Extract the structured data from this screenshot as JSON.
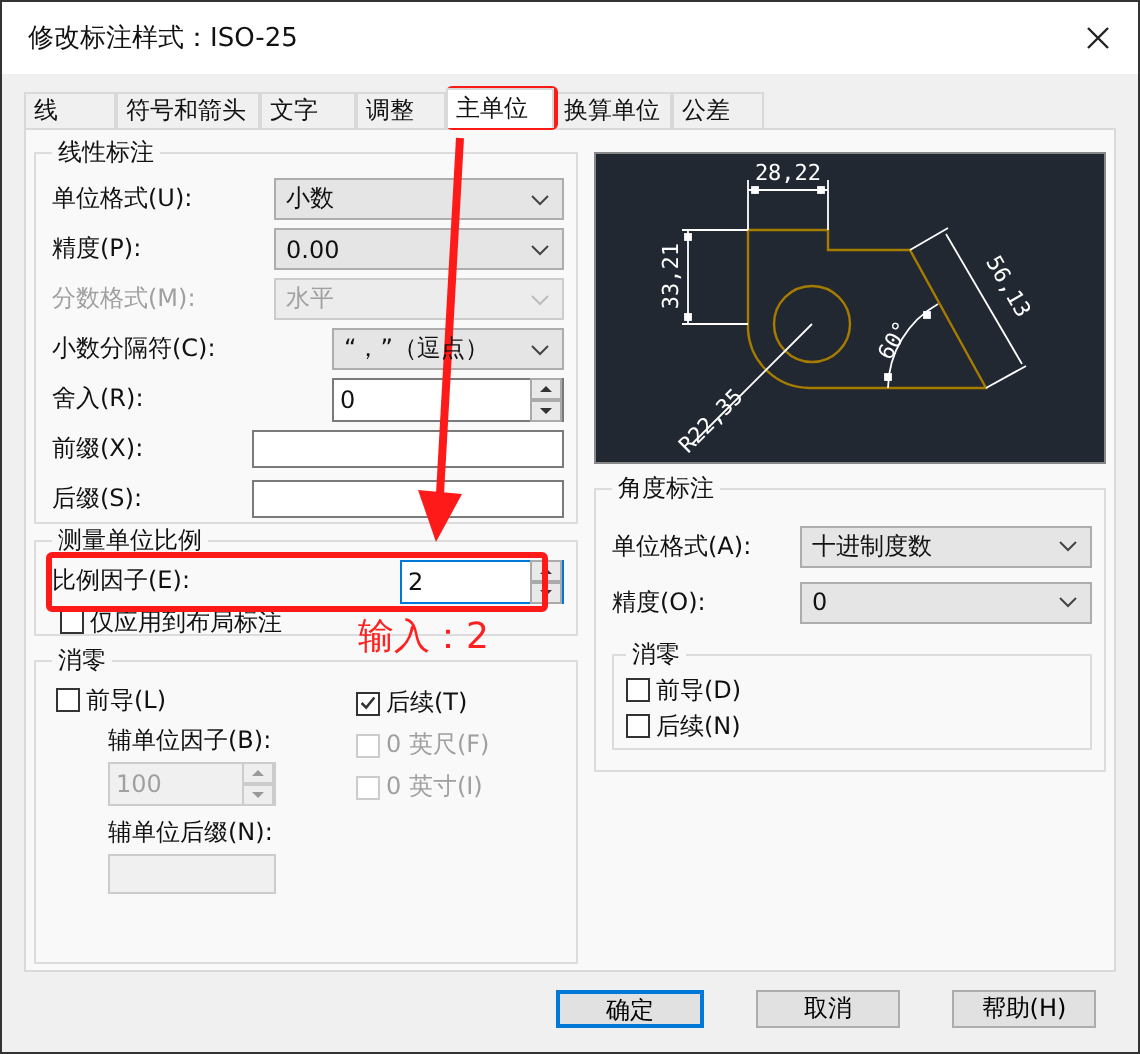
{
  "window": {
    "title": "修改标注样式：ISO-25"
  },
  "tabs": [
    {
      "label": "线",
      "selected": false
    },
    {
      "label": "符号和箭头",
      "selected": false
    },
    {
      "label": "文字",
      "selected": false
    },
    {
      "label": "调整",
      "selected": false
    },
    {
      "label": "主单位",
      "selected": true
    },
    {
      "label": "换算单位",
      "selected": false
    },
    {
      "label": "公差",
      "selected": false
    }
  ],
  "linear": {
    "title": "线性标注",
    "fields": [
      {
        "kind": "select",
        "label": "单位格式(U):",
        "value": "小数",
        "disabled": false
      },
      {
        "kind": "select",
        "label": "精度(P):",
        "value": "0.00",
        "disabled": false
      },
      {
        "kind": "select",
        "label": "分数格式(M):",
        "value": "水平",
        "disabled": true
      },
      {
        "kind": "select",
        "label": "小数分隔符(C):",
        "value": "“，”（逗点）",
        "disabled": false
      },
      {
        "kind": "spinner",
        "label": "舍入(R):",
        "value": "0"
      },
      {
        "kind": "text",
        "label": "前缀(X):"
      },
      {
        "kind": "text",
        "label": "后缀(S):"
      }
    ]
  },
  "scale": {
    "title": "测量单位比例",
    "factor": {
      "label": "比例因子(E):",
      "value": "2"
    },
    "layout_only": {
      "label": "仅应用到布局标注",
      "checked": false
    }
  },
  "zero": {
    "title": "消零",
    "leading": {
      "label": "前导(L)",
      "checked": false,
      "disabled": false
    },
    "sub_factor": {
      "label": "辅单位因子(B):",
      "value": "100",
      "disabled": true
    },
    "sub_suffix": {
      "label": "辅单位后缀(N):"
    },
    "trailing": {
      "label": "后续(T)",
      "checked": true,
      "disabled": false
    },
    "feet": {
      "label": "0 英尺(F)",
      "checked": false,
      "disabled": true
    },
    "inches": {
      "label": "0 英寸(I)",
      "checked": false,
      "disabled": true
    }
  },
  "preview": {
    "labels": [
      "28,22",
      "33,21",
      "56,13",
      "60°",
      "R22,35"
    ]
  },
  "angular": {
    "title": "角度标注",
    "fields": [
      {
        "kind": "select",
        "label": "单位格式(A):",
        "value": "十进制度数",
        "disabled": false
      },
      {
        "kind": "select",
        "label": "精度(O):",
        "value": "0",
        "disabled": false
      }
    ],
    "zero": {
      "title": "消零",
      "leading": {
        "label": "前导(D)",
        "checked": false
      },
      "trailing": {
        "label": "后续(N)",
        "checked": false
      }
    }
  },
  "buttons": [
    {
      "label": "确定",
      "default": true
    },
    {
      "label": "取消",
      "default": false
    },
    {
      "label": "帮助(H)",
      "default": false
    }
  ],
  "annotation": {
    "text": "输入：2"
  }
}
